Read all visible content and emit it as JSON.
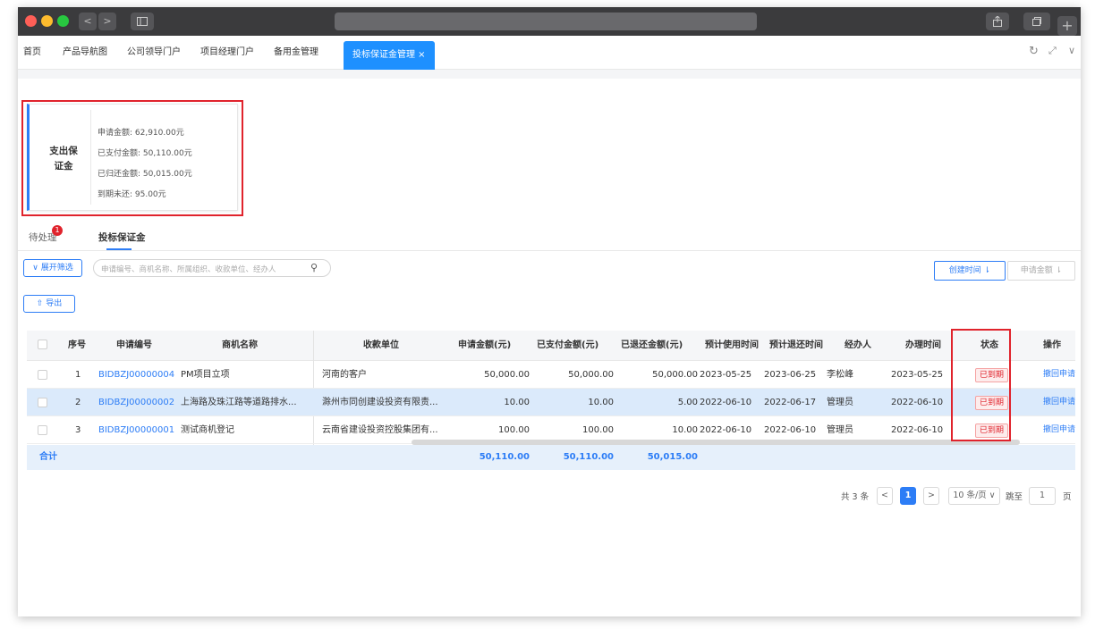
{
  "browser": {
    "nav_back": "<",
    "nav_forward": ">",
    "new_tab": "+"
  },
  "tabs": [
    {
      "label": "首页"
    },
    {
      "label": "产品导航图"
    },
    {
      "label": "公司领导门户"
    },
    {
      "label": "项目经理门户"
    },
    {
      "label": "备用金管理"
    },
    {
      "label": "投标保证金管理 ×"
    }
  ],
  "summary": {
    "title": "支出保证金",
    "lines": [
      "申请金额: 62,910.00元",
      "已支付金额: 50,110.00元",
      "已归还金额: 50,015.00元",
      "到期未还: 95.00元"
    ]
  },
  "subtabs": {
    "pending": "待处理",
    "pending_badge": "1",
    "deposit": "投标保证金"
  },
  "toolbar": {
    "filter_label": "∨ 展开筛选",
    "search_placeholder": "申请编号、商机名称、所属组织、收款单位、经办人",
    "export_label": "导出",
    "sort_created": "创建时间 ⇂",
    "sort_amount": "申请金额 ⇂"
  },
  "table": {
    "headers": [
      "序号",
      "申请编号",
      "商机名称",
      "收款单位",
      "申请金额(元)",
      "已支付金额(元)",
      "已退还金额(元)",
      "预计使用时间",
      "预计退还时间",
      "经办人",
      "办理时间",
      "状态",
      "操作"
    ],
    "rows": [
      {
        "no": "1",
        "code": "BIDBZJ00000004",
        "opportunity": "PM项目立项",
        "payee": "河南的客户",
        "apply": "50,000.00",
        "paid": "50,000.00",
        "refunded": "50,000.00",
        "use_date": "2023-05-25",
        "return_date": "2023-06-25",
        "handler": "李松峰",
        "process_date": "2023-05-25",
        "status": "已到期",
        "op": "撤回申请"
      },
      {
        "no": "2",
        "code": "BIDBZJ00000002",
        "opportunity": "上海路及珠江路等道路排水...",
        "payee": "滁州市同创建设投资有限责...",
        "apply": "10.00",
        "paid": "10.00",
        "refunded": "5.00",
        "use_date": "2022-06-10",
        "return_date": "2022-06-17",
        "handler": "管理员",
        "process_date": "2022-06-10",
        "status": "已到期",
        "op": "撤回申请"
      },
      {
        "no": "3",
        "code": "BIDBZJ00000001",
        "opportunity": "测试商机登记",
        "payee": "云南省建设投资控股集团有...",
        "apply": "100.00",
        "paid": "100.00",
        "refunded": "10.00",
        "use_date": "2022-06-10",
        "return_date": "2022-06-10",
        "handler": "管理员",
        "process_date": "2022-06-10",
        "status": "已到期",
        "op": "撤回申请"
      }
    ],
    "total": {
      "label": "合计",
      "apply": "50,110.00",
      "paid": "50,110.00",
      "refunded": "50,015.00"
    }
  },
  "pagination": {
    "total_text": "共 3 条",
    "prev": "<",
    "current": "1",
    "next": ">",
    "page_size": "10 条/页 ∨",
    "goto_label": "跳至",
    "goto_value": "1",
    "page_unit": "页"
  },
  "colors": {
    "accent": "#2d7df6",
    "status_red": "#e0232c",
    "highlight_row": "#dbeafb"
  }
}
